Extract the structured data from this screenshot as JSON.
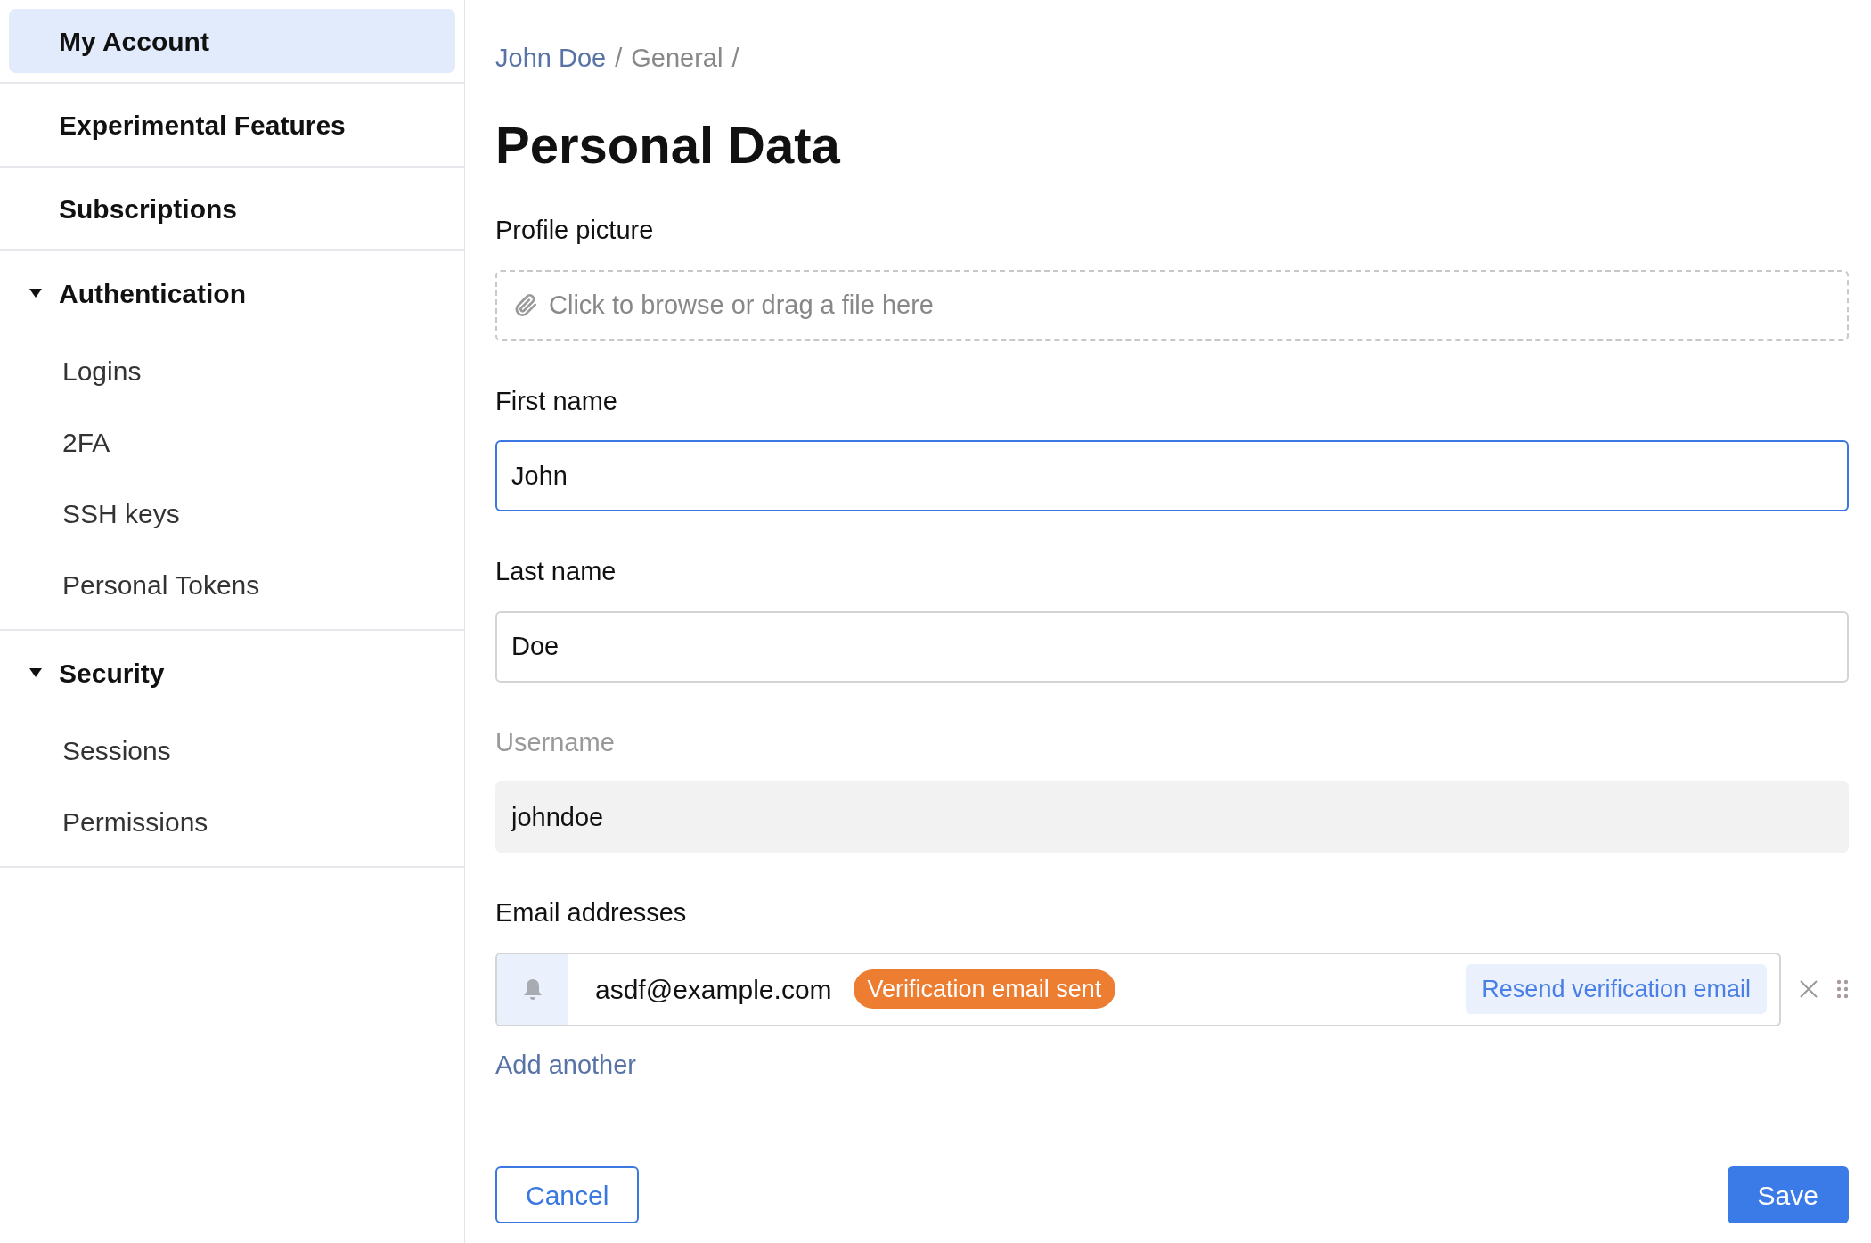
{
  "sidebar": {
    "items": [
      {
        "kind": "link",
        "label": "My Account",
        "selected": true
      },
      {
        "kind": "link",
        "label": "Experimental Features",
        "selected": false
      },
      {
        "kind": "link",
        "label": "Subscriptions",
        "selected": false
      },
      {
        "kind": "group",
        "label": "Authentication",
        "expanded": true,
        "children": [
          {
            "label": "Logins",
            "selected": false
          },
          {
            "label": "2FA",
            "selected": false
          },
          {
            "label": "SSH keys",
            "selected": false
          },
          {
            "label": "Personal Tokens",
            "selected": false
          }
        ]
      },
      {
        "kind": "group",
        "label": "Security",
        "expanded": true,
        "children": [
          {
            "label": "Sessions",
            "selected": false
          },
          {
            "label": "Permissions",
            "selected": false
          }
        ]
      }
    ]
  },
  "breadcrumb": [
    {
      "label": "John Doe",
      "link": true,
      "separator": "/"
    },
    {
      "label": "General",
      "link": false,
      "separator": "/"
    }
  ],
  "title": "Personal Data",
  "fields": [
    {
      "kind": "file",
      "label": "Profile picture",
      "placeholder": "Click to browse or drag a file here"
    },
    {
      "kind": "text",
      "label": "First name",
      "value": "John",
      "focused": true,
      "disabled": false
    },
    {
      "kind": "text",
      "label": "Last name",
      "value": "Doe",
      "focused": false,
      "disabled": false
    },
    {
      "kind": "text",
      "label": "Username",
      "value": "johndoe",
      "focused": false,
      "disabled": true
    }
  ],
  "emails": {
    "label": "Email addresses",
    "items": [
      {
        "address": "asdf@example.com",
        "badge": "Verification email sent",
        "color": "#ed7d31",
        "action": "Resend verification email"
      }
    ],
    "add": "Add another"
  },
  "buttons": {
    "cancel": "Cancel",
    "save": "Save"
  }
}
